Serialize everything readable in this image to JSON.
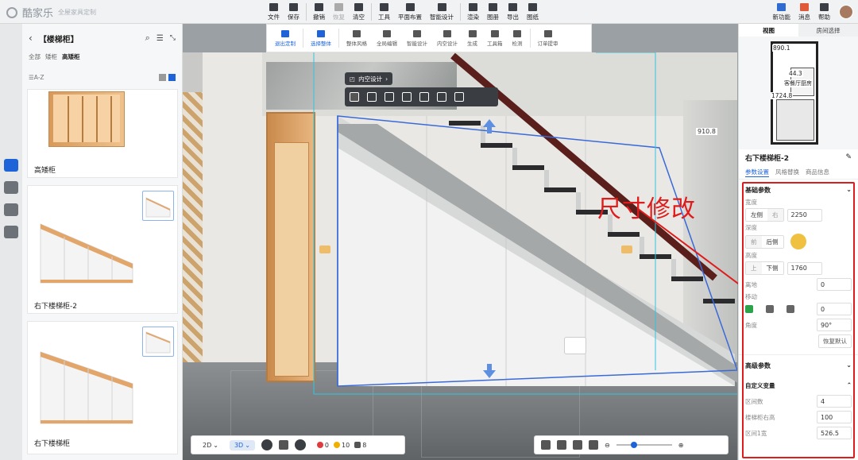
{
  "app": {
    "name": "酷家乐",
    "subtitle": "全屋家具定制"
  },
  "toolbar": {
    "main": [
      {
        "label": "文件",
        "icon": "file-icon"
      },
      {
        "label": "保存",
        "icon": "save-icon"
      }
    ],
    "edit": [
      {
        "label": "撤销",
        "icon": "undo-icon",
        "disabled": false
      },
      {
        "label": "恢复",
        "icon": "redo-icon",
        "disabled": true
      },
      {
        "label": "清空",
        "icon": "clear-icon",
        "disabled": false
      }
    ],
    "tools": [
      {
        "label": "工具",
        "icon": "wrench-icon"
      },
      {
        "label": "平面布置",
        "icon": "layout-icon"
      },
      {
        "label": "智能设计",
        "icon": "lightning-icon"
      }
    ],
    "render": [
      {
        "label": "渲染",
        "icon": "camera-icon"
      },
      {
        "label": "图册",
        "icon": "album-icon"
      },
      {
        "label": "导出",
        "icon": "export-icon"
      },
      {
        "label": "图纸",
        "icon": "drawing-icon"
      }
    ],
    "right": [
      {
        "label": "新功能",
        "icon": "new-feature-icon"
      },
      {
        "label": "消息",
        "icon": "gift-icon"
      },
      {
        "label": "帮助",
        "icon": "help-icon"
      }
    ]
  },
  "subtoolbar": [
    {
      "label": "退出定制",
      "icon": "exit-icon"
    },
    {
      "label": "选择整体",
      "icon": "select-all-icon"
    },
    {
      "label": "整体风格",
      "icon": "style-icon"
    },
    {
      "label": "全局编辑",
      "icon": "global-edit-icon"
    },
    {
      "label": "智能设计",
      "icon": "bulb-icon"
    },
    {
      "label": "内空设计",
      "icon": "inner-space-icon"
    },
    {
      "label": "生成",
      "icon": "generate-icon"
    },
    {
      "label": "工具箱",
      "icon": "toolbox-icon"
    },
    {
      "label": "检测",
      "icon": "detect-icon"
    },
    {
      "label": "订单提审",
      "icon": "order-icon"
    }
  ],
  "left_panel": {
    "title": "【楼梯柜】",
    "tabs": [
      "全部",
      "矮柜",
      "高矮柜"
    ],
    "sort_label": "A-Z",
    "cards": [
      {
        "name": "高矮柜"
      },
      {
        "name": "右下楼梯柜-2"
      },
      {
        "name": "右下楼梯柜"
      }
    ]
  },
  "scene": {
    "float_tag": "内空设计",
    "dimension": "910.8",
    "annotation": "尺寸修改"
  },
  "bottom": {
    "view_2d": "2D",
    "view_3d": "3D",
    "status": {
      "errors": "0",
      "warnings": "10",
      "items": "8"
    },
    "colors": {
      "error": "#e03b3b",
      "warning": "#f0b000"
    }
  },
  "minimap": {
    "tabs": [
      "视图",
      "房间选择"
    ],
    "dims": [
      "890.1",
      "44.3",
      "1724.8"
    ],
    "room_label": "客餐厅厨房"
  },
  "properties": {
    "title": "右下楼梯柜-2",
    "tabs": [
      "参数设置",
      "风格替换",
      "商品信息"
    ],
    "basic_section": "基础参数",
    "width": {
      "label": "宽度",
      "left": "左侧",
      "right": "右",
      "value": "2250"
    },
    "depth": {
      "label": "深度",
      "front": "前",
      "back": "后侧"
    },
    "height": {
      "label": "高度",
      "top": "上",
      "bottom": "下侧",
      "value": "1760"
    },
    "floor_height": {
      "label": "离地",
      "value": "0"
    },
    "move": {
      "label": "移动",
      "value": "0"
    },
    "angle": {
      "label": "角度",
      "value": "90°"
    },
    "reset_label": "恢复默认",
    "advanced_section": "高级参数",
    "custom_section": "自定义变量",
    "custom": [
      {
        "label": "区间数",
        "value": "4"
      },
      {
        "label": "楼梯柜右高",
        "value": "100"
      },
      {
        "label": "区间1宽",
        "value": "526.5"
      }
    ]
  }
}
